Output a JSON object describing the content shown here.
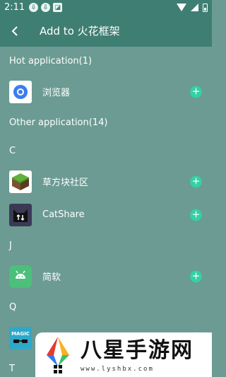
{
  "status": {
    "time": "2:11"
  },
  "toolbar": {
    "back_glyph": "‹",
    "title": "Add to 火花框架"
  },
  "sections": {
    "hot_header": "Hot application(1)",
    "other_header": "Other application(14)"
  },
  "letters": {
    "c": "C",
    "j": "J",
    "q": "Q",
    "t": "T"
  },
  "apps": {
    "browser": "浏览器",
    "grass": "草方块社区",
    "catshare": "CatShare",
    "jianruan": "简软"
  },
  "magic_icon_text": "MAGIC",
  "add_glyph": "+",
  "watermark": {
    "cn": "八星手游网",
    "url": "www.lyshbx.com"
  },
  "colors": {
    "background": "#6b9b92",
    "bar": "#3f7e73",
    "accent": "#35d0a3"
  }
}
